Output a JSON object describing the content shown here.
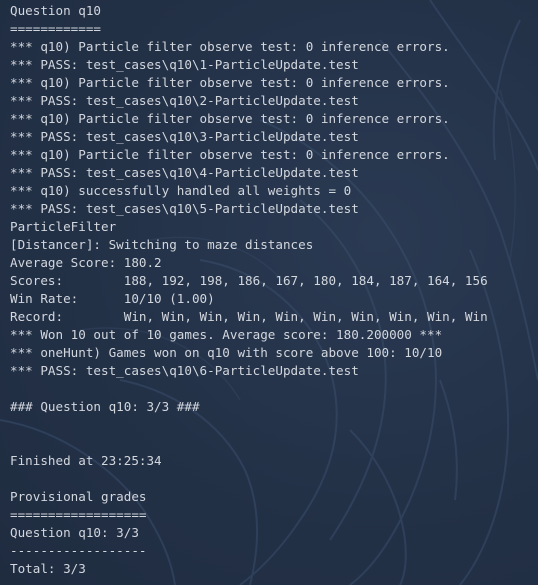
{
  "terminal": {
    "lines": [
      "Question q10",
      "============",
      "*** q10) Particle filter observe test: 0 inference errors.",
      "*** PASS: test_cases\\q10\\1-ParticleUpdate.test",
      "*** q10) Particle filter observe test: 0 inference errors.",
      "*** PASS: test_cases\\q10\\2-ParticleUpdate.test",
      "*** q10) Particle filter observe test: 0 inference errors.",
      "*** PASS: test_cases\\q10\\3-ParticleUpdate.test",
      "*** q10) Particle filter observe test: 0 inference errors.",
      "*** PASS: test_cases\\q10\\4-ParticleUpdate.test",
      "*** q10) successfully handled all weights = 0",
      "*** PASS: test_cases\\q10\\5-ParticleUpdate.test",
      "ParticleFilter",
      "[Distancer]: Switching to maze distances",
      "Average Score: 180.2",
      "Scores:        188, 192, 198, 186, 167, 180, 184, 187, 164, 156",
      "Win Rate:      10/10 (1.00)",
      "Record:        Win, Win, Win, Win, Win, Win, Win, Win, Win, Win",
      "*** Won 10 out of 10 games. Average score: 180.200000 ***",
      "*** oneHunt) Games won on q10 with score above 100: 10/10",
      "*** PASS: test_cases\\q10\\6-ParticleUpdate.test",
      "",
      "### Question q10: 3/3 ###",
      "",
      "",
      "Finished at 23:25:34",
      "",
      "Provisional grades",
      "==================",
      "Question q10: 3/3",
      "------------------",
      "Total: 3/3"
    ]
  }
}
